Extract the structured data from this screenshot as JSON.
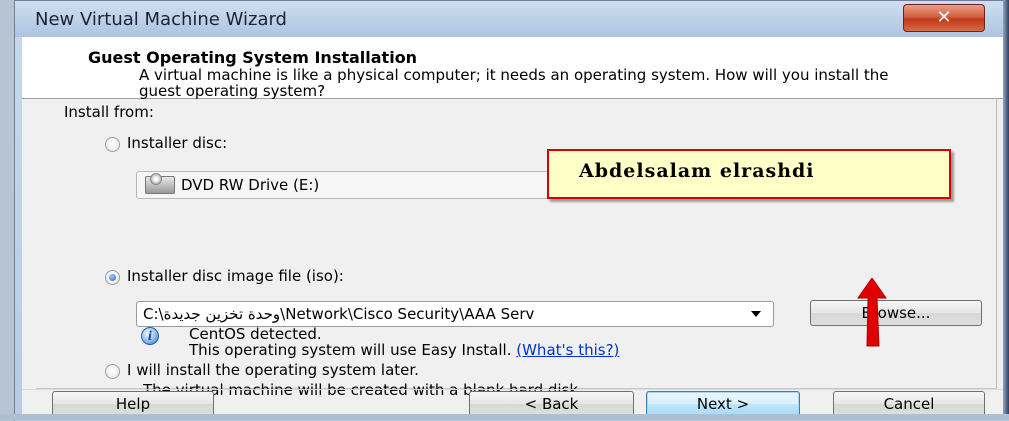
{
  "window": {
    "title": "New Virtual Machine Wizard",
    "close_glyph": "✕"
  },
  "header": {
    "title": "Guest Operating System Installation",
    "description": "A virtual machine is like a physical computer; it needs an operating system. How will you install the guest operating system?"
  },
  "install_from": {
    "label": "Install from:",
    "installer_disc": {
      "label": "Installer disc:",
      "selected": false,
      "drive": "DVD RW Drive (E:)",
      "drive_icon": "dvd-drive-icon"
    },
    "iso": {
      "label": "Installer disc image file (iso):",
      "selected": true,
      "path_value": "C:\\وحدة تخزين جديدة\\Network\\Cisco Security\\AAA Serv",
      "browse_label": "Browse...",
      "detected_icon": "info-icon",
      "detected_title": "CentOS detected.",
      "detected_desc": "This operating system will use Easy Install.",
      "whats_this": "(What's this?)"
    },
    "later": {
      "label": "I will install the operating system later.",
      "selected": false,
      "desc": "The virtual machine will be created with a blank hard disk."
    }
  },
  "annotation": {
    "text": "Abdelsalam elrashdi",
    "box_color": "#ffffc8",
    "border_color": "#d40000",
    "arrow_color": "#e00000"
  },
  "footer": {
    "help": "Help",
    "back": "< Back",
    "next": "Next >",
    "cancel": "Cancel"
  }
}
